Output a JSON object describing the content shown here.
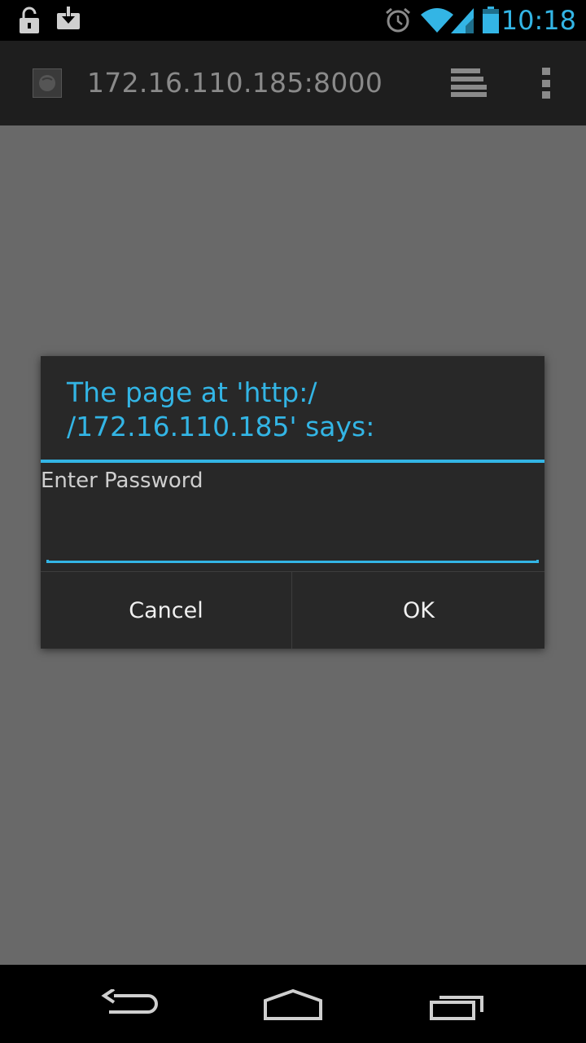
{
  "status_bar": {
    "time": "10:18",
    "icons": [
      "unlock-icon",
      "download-icon",
      "alarm-icon",
      "wifi-icon",
      "signal-icon",
      "battery-icon"
    ]
  },
  "browser": {
    "url": "172.16.110.185:8000",
    "icons": [
      "favicon-icon",
      "tabs-icon",
      "overflow-menu-icon"
    ]
  },
  "dialog": {
    "title": "The page at 'http:/\n/172.16.110.185' says:",
    "message": "Enter Password",
    "input_value": "",
    "cancel_label": "Cancel",
    "ok_label": "OK"
  },
  "nav_bar": {
    "icons": [
      "back-icon",
      "home-icon",
      "recent-apps-icon"
    ]
  },
  "colors": {
    "accent": "#33b5e5",
    "dim_background": "#696969",
    "dialog_background": "#282828"
  }
}
